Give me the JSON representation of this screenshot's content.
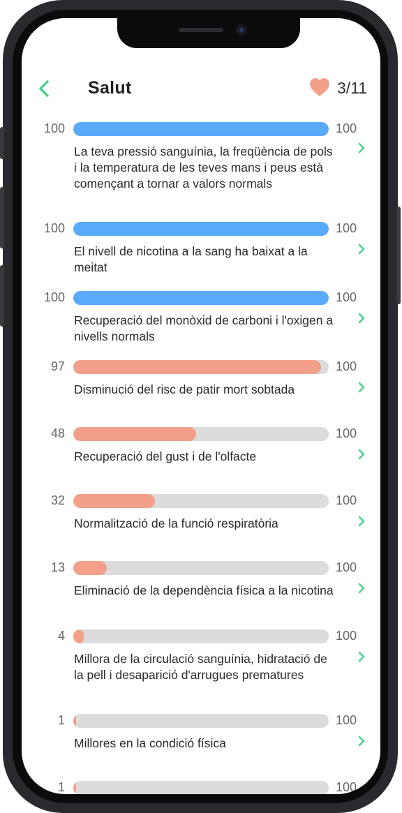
{
  "header": {
    "title": "Salut",
    "counter": "3/11",
    "back_icon": "chevron-left-icon",
    "heart_icon": "heart-icon",
    "accent_color": "#4fd08e",
    "heart_color": "#f3a08a"
  },
  "colors": {
    "complete": "#5aaafb",
    "progress": "#f3a08a",
    "track": "#dcdcdc"
  },
  "items": [
    {
      "value": 100,
      "max": "100",
      "label": "100",
      "desc": "La teva pressió sanguínia, la freqüència de pols i la temperatura de les teves mans i peus està començant a tornar a valors normals"
    },
    {
      "value": 100,
      "max": "100",
      "label": "100",
      "desc": "El nivell de nicotina a la sang ha baixat a la meitat"
    },
    {
      "value": 100,
      "max": "100",
      "label": "100",
      "desc": "Recuperació del monòxid de carboni i l'oxigen a nivells normals"
    },
    {
      "value": 97,
      "max": "100",
      "label": "97",
      "desc": "Disminució del risc de patir mort sobtada"
    },
    {
      "value": 48,
      "max": "100",
      "label": "48",
      "desc": "Recuperació del gust i de l'olfacte"
    },
    {
      "value": 32,
      "max": "100",
      "label": "32",
      "desc": "Normalització de la funció respiratòria"
    },
    {
      "value": 13,
      "max": "100",
      "label": "13",
      "desc": "Eliminació de la dependència física a la nicotina"
    },
    {
      "value": 4,
      "max": "100",
      "label": "4",
      "desc": "Millora de la circulació sanguínia, hidratació de la pell i desaparició d'arrugues prematures"
    },
    {
      "value": 1,
      "max": "100",
      "label": "1",
      "desc": "Millores en la condició física"
    },
    {
      "value": 1,
      "max": "100",
      "label": "1",
      "desc": ""
    }
  ]
}
